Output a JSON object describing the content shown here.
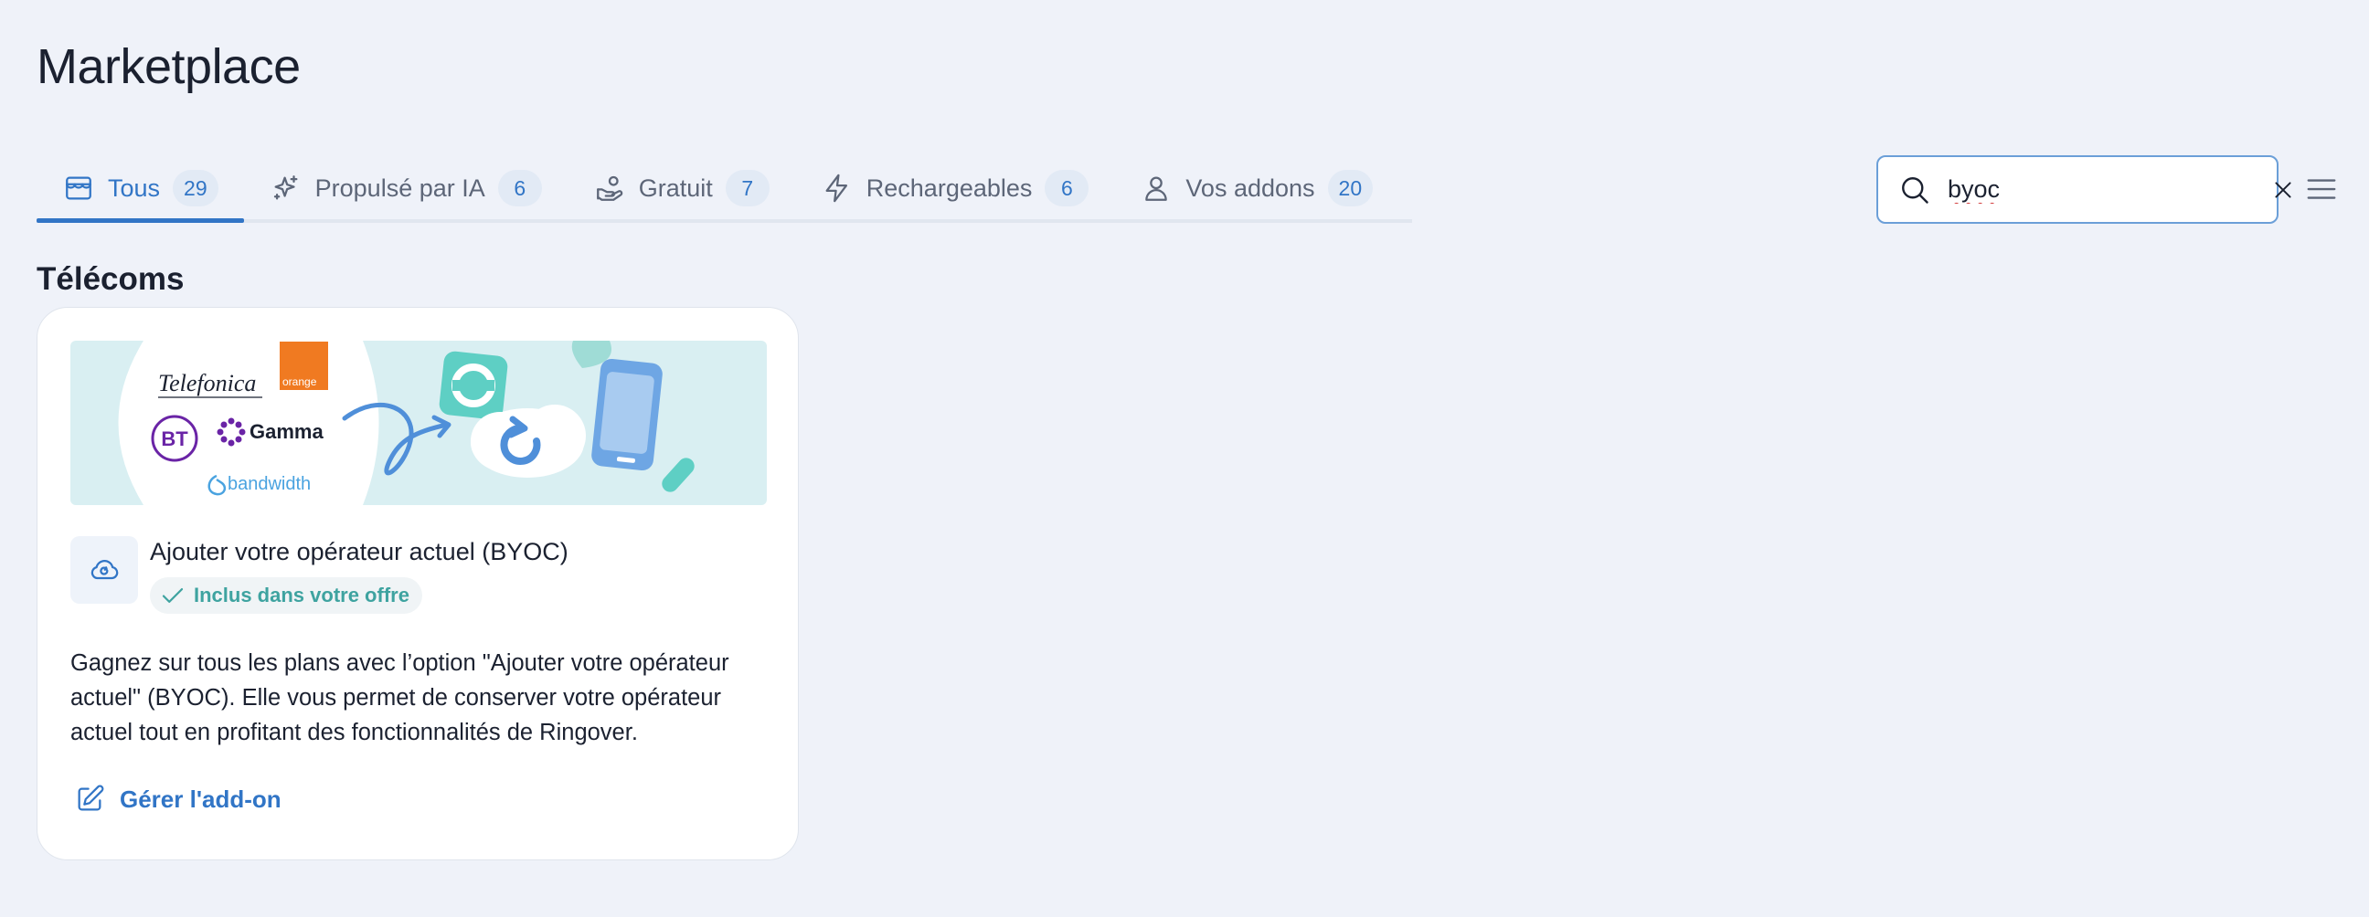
{
  "page": {
    "title": "Marketplace"
  },
  "tabs": [
    {
      "label": "Tous",
      "count": "29",
      "icon": "store-icon",
      "active": true
    },
    {
      "label": "Propulsé par IA",
      "count": "6",
      "icon": "sparkles-icon",
      "active": false
    },
    {
      "label": "Gratuit",
      "count": "7",
      "icon": "hand-coins-icon",
      "active": false
    },
    {
      "label": "Rechargeables",
      "count": "6",
      "icon": "bolt-icon",
      "active": false
    },
    {
      "label": "Vos addons",
      "count": "20",
      "icon": "user-icon",
      "active": false
    }
  ],
  "search": {
    "value": "byoc"
  },
  "section": {
    "title": "Télécoms"
  },
  "card": {
    "banner_logos": {
      "telefonica": "Telefonica",
      "orange": "orange",
      "bt": "BT",
      "gamma": "Gamma",
      "bandwidth": "bandwidth"
    },
    "title": "Ajouter votre opérateur actuel (BYOC)",
    "badge": "Inclus dans votre offre",
    "description": "Gagnez sur tous les plans avec l’option \"Ajouter votre opérateur actuel\" (BYOC). Elle vous permet de conserver votre opérateur actuel tout en profitant des fonctionnalités de Ringover.",
    "action": "Gérer l'add-on"
  },
  "colors": {
    "accent": "#3175c6",
    "included": "#3ea3a0",
    "background": "#eff2f9"
  }
}
